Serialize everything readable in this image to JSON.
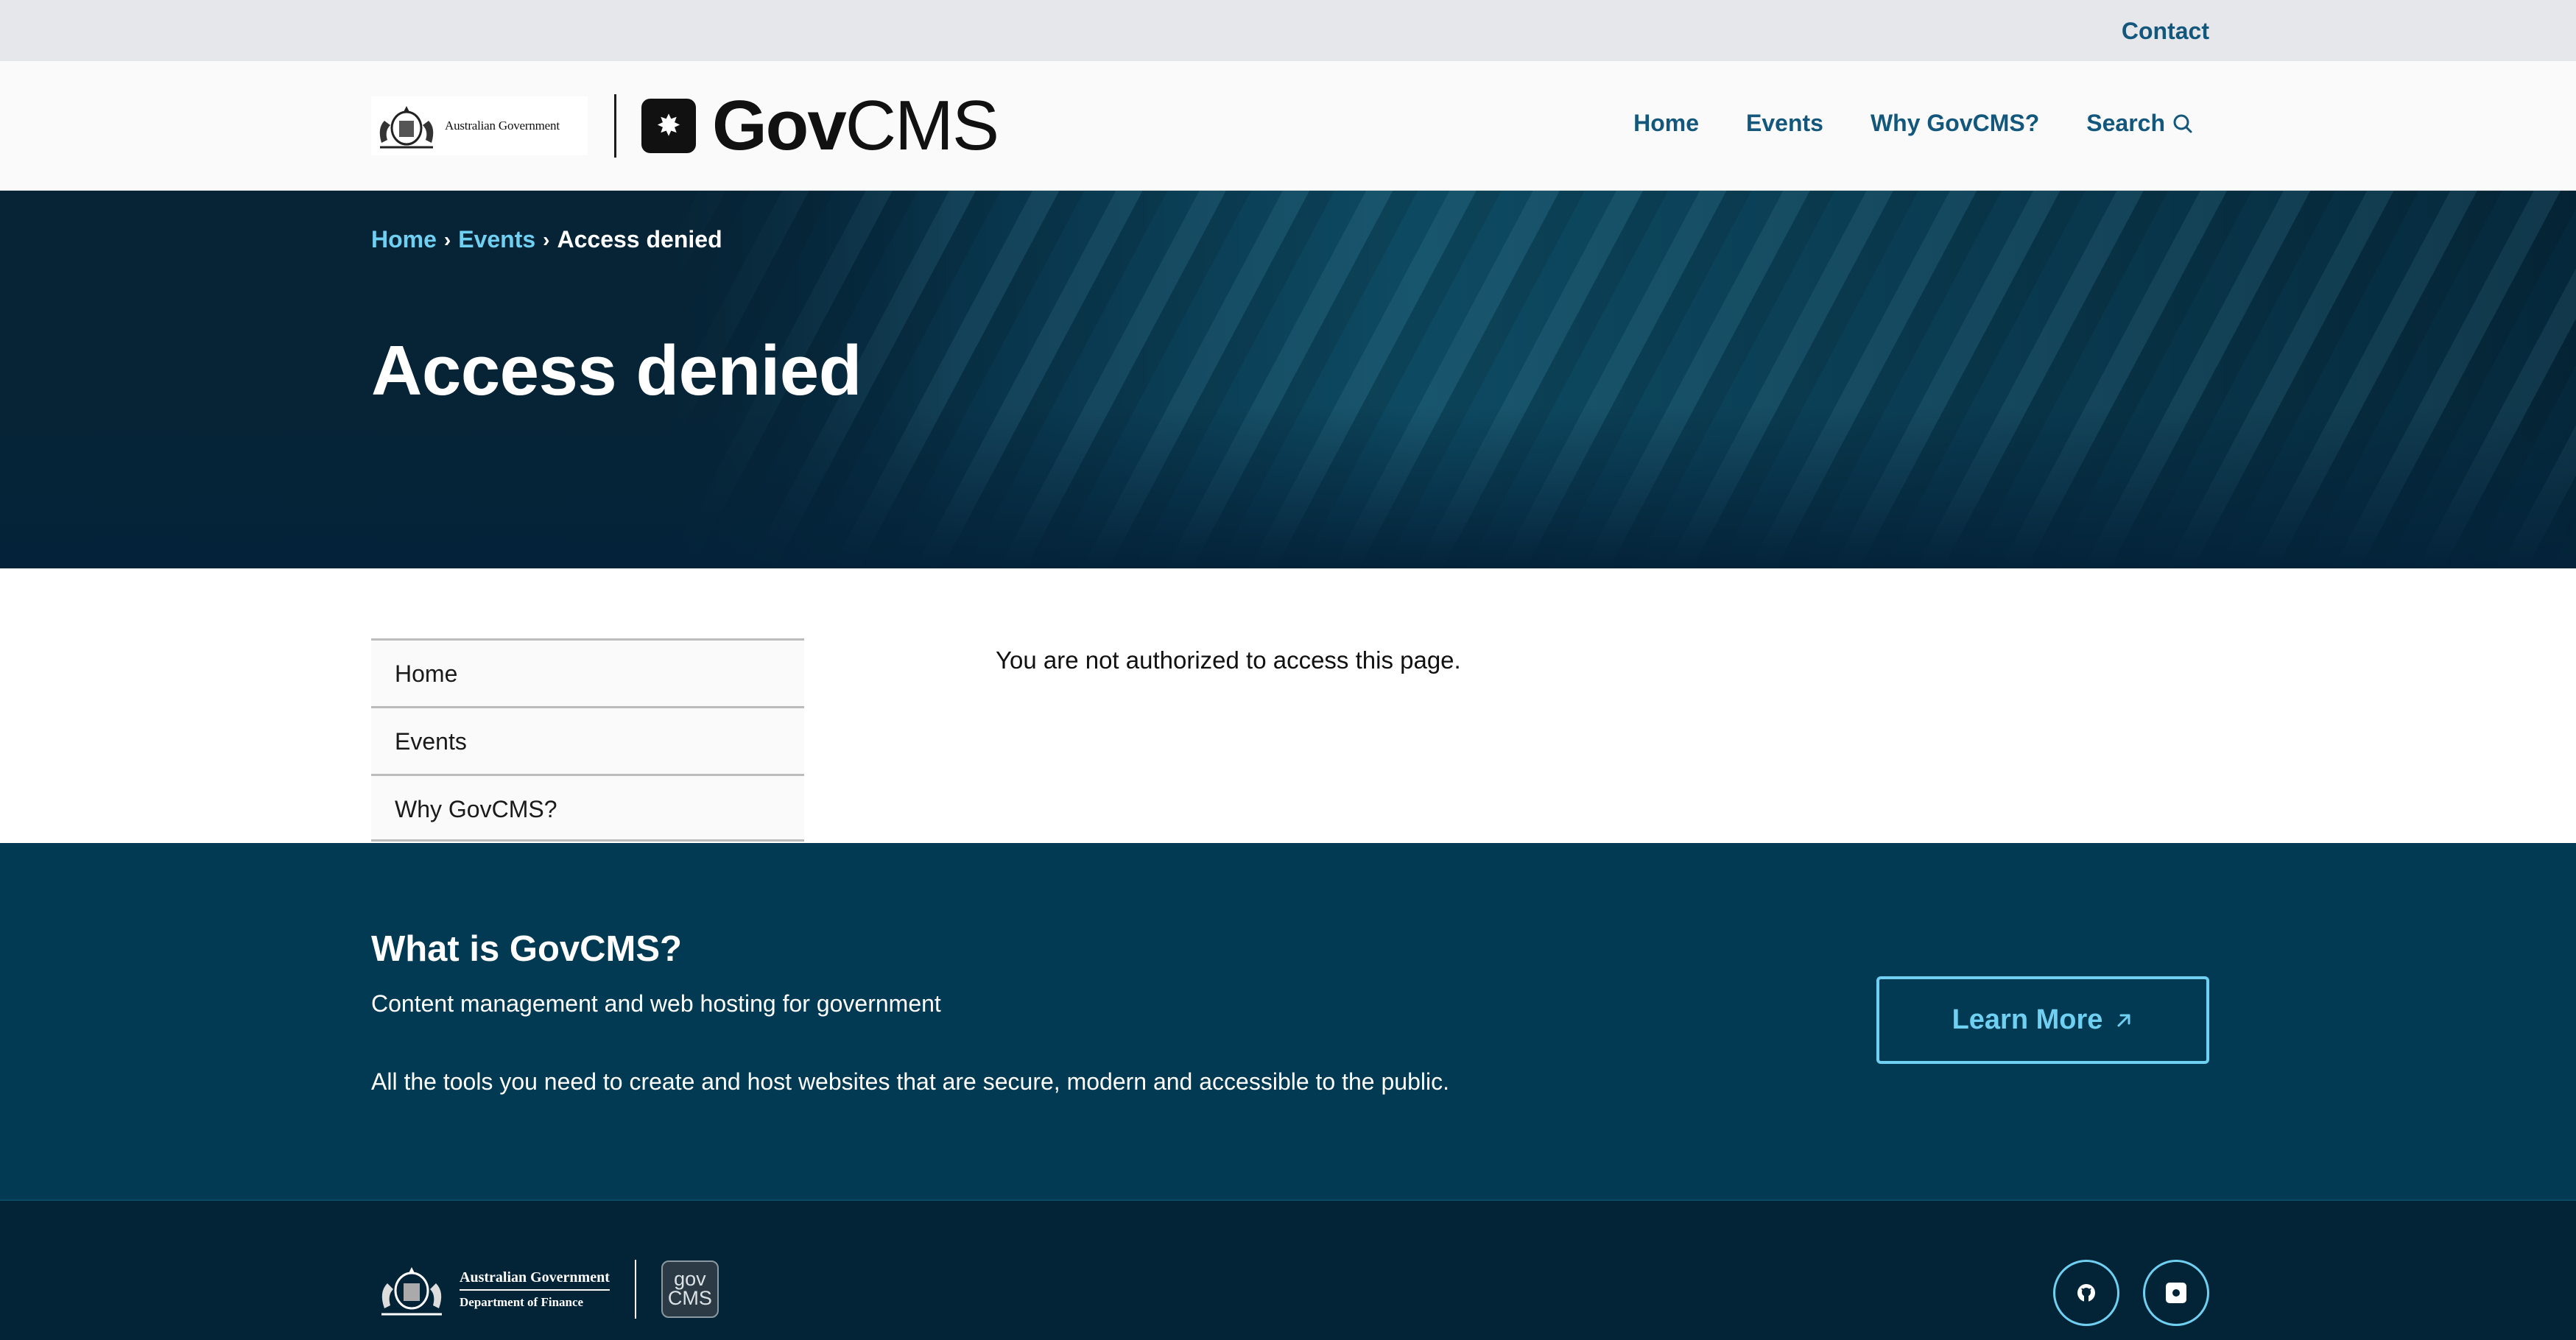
{
  "topbar": {
    "contact": "Contact"
  },
  "header": {
    "gov_logo_text": "Australian Government",
    "brand": {
      "bold": "Gov",
      "regular": "CMS"
    },
    "nav": [
      {
        "label": "Home"
      },
      {
        "label": "Events"
      },
      {
        "label": "Why GovCMS?"
      },
      {
        "label": "Search",
        "icon": "search-icon"
      }
    ]
  },
  "hero": {
    "breadcrumb": [
      {
        "label": "Home"
      },
      {
        "label": "Events"
      }
    ],
    "breadcrumb_current": "Access denied",
    "title": "Access denied"
  },
  "sidebar": {
    "items": [
      {
        "label": "Home"
      },
      {
        "label": "Events"
      },
      {
        "label": "Why GovCMS?"
      }
    ]
  },
  "main": {
    "message": "You are not authorized to access this page."
  },
  "promo": {
    "title": "What is GovCMS?",
    "subtitle": "Content management and web hosting for government",
    "description": "All the tools you need to create and host websites that are secure, modern and accessible to the public.",
    "button_label": "Learn More"
  },
  "footer": {
    "gov_line1": "Australian Government",
    "gov_line2": "Department of Finance",
    "govcms_badge_top": "gov",
    "govcms_badge_bottom": "CMS",
    "social": [
      {
        "icon": "github-icon"
      },
      {
        "icon": "govcms-icon"
      }
    ]
  },
  "colors": {
    "primary_link": "#13587c",
    "hero_bg": "#062a40",
    "accent_cyan": "#6fd0f2",
    "promo_bg": "#013a52",
    "footer_bg": "#032436"
  }
}
